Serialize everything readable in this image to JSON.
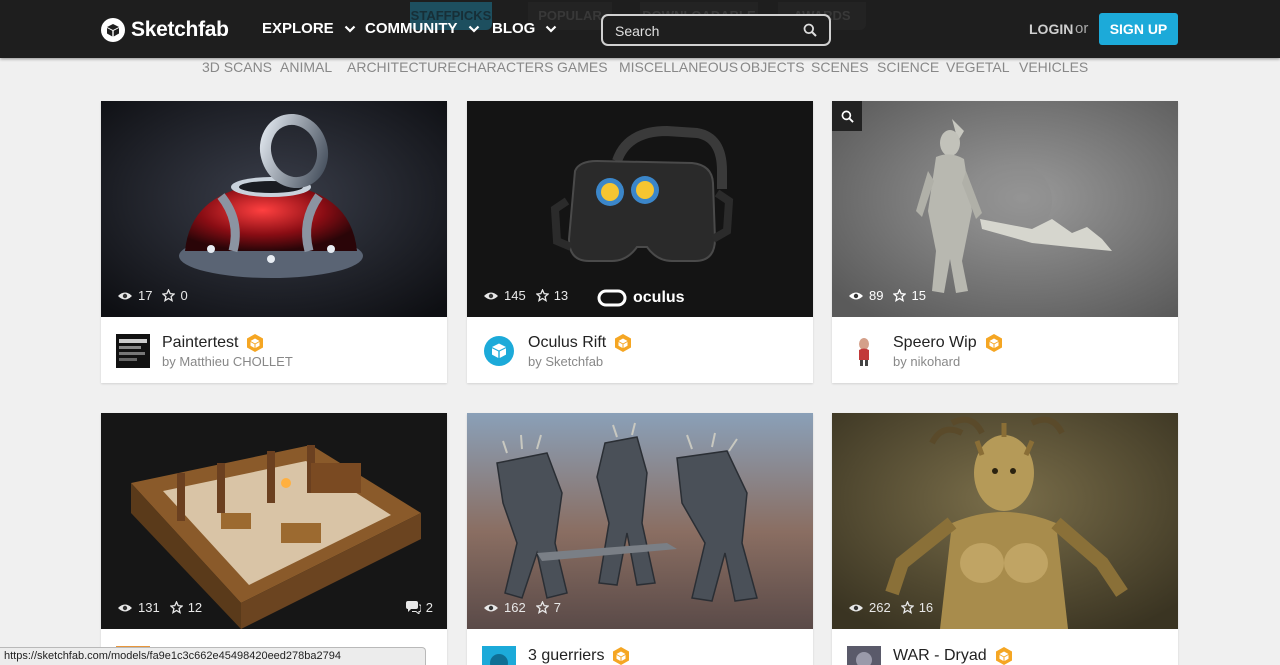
{
  "header": {
    "brand": "Sketchfab",
    "nav": [
      {
        "label": "EXPLORE"
      },
      {
        "label": "COMMUNITY"
      },
      {
        "label": "BLOG"
      }
    ],
    "background_tabs": [
      "STAFFPICKS",
      "POPULAR",
      "DOWNLOADABLE",
      "AWARDS"
    ],
    "search_placeholder": "Search",
    "login": "LOGIN",
    "or": "or",
    "signup": "SIGN UP",
    "accent_color": "#1caad9"
  },
  "categories": [
    "3D SCANS",
    "ANIMAL",
    "ARCHITECTURE",
    "CHARACTERS",
    "GAMES",
    "MISCELLANEOUS",
    "OBJECTS",
    "SCENES",
    "SCIENCE",
    "VEGETAL",
    "VEHICLES"
  ],
  "cards": [
    {
      "title": "Paintertest",
      "author": "by Matthieu CHOLLET",
      "views": "17",
      "likes": "0"
    },
    {
      "title": "Oculus Rift",
      "author": "by Sketchfab",
      "views": "145",
      "likes": "13",
      "brand_overlay": "oculus"
    },
    {
      "title": "Speero Wip",
      "author": "by nikohard",
      "views": "89",
      "likes": "15"
    },
    {
      "title": "",
      "author": "",
      "views": "131",
      "likes": "12",
      "comments": "2"
    },
    {
      "title": "3 guerriers",
      "author": "",
      "views": "162",
      "likes": "7"
    },
    {
      "title": "WAR - Dryad",
      "author": "",
      "views": "262",
      "likes": "16"
    }
  ],
  "status_url": "https://sketchfab.com/models/fa9e1c3c662e45498420eed278ba2794"
}
